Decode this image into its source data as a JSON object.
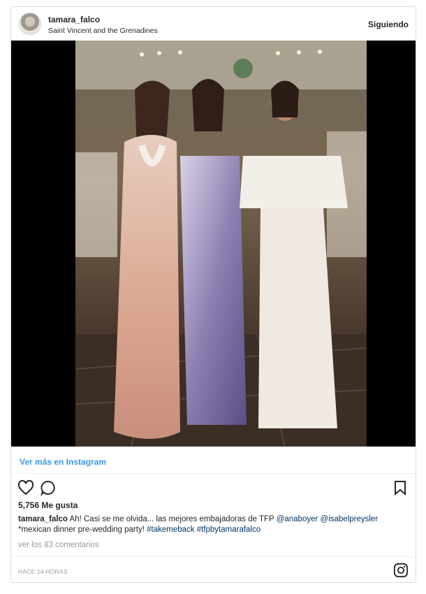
{
  "post": {
    "username": "tamara_falco",
    "location": "Saint Vincent and the Grenadines",
    "follow_label": "Siguiendo"
  },
  "embed": {
    "view_more_label": "Ver más en Instagram"
  },
  "actions": {
    "like_icon": "heart-icon",
    "comment_icon": "comment-icon",
    "save_icon": "bookmark-icon"
  },
  "likes_text": "5,756 Me gusta",
  "caption": {
    "author": "tamara_falco",
    "text_part1": "Ah! Casi se me olvida... las mejores embajadoras de TFP ",
    "mention1": "@anaboyer",
    "mention2": "@isabelpreysler",
    "text_part2": "*mexican dinner pre-wedding party! ",
    "hashtag1": "#takemeback",
    "hashtag2": "#tfpbytamarafalco"
  },
  "comments_link": "ver los 83 comentarios",
  "timestamp": "HACE 14 HORAS",
  "colors": {
    "link_blue": "#3897f0",
    "tag_blue": "#003569",
    "muted_gray": "#999999",
    "border": "#dbdbdb"
  }
}
